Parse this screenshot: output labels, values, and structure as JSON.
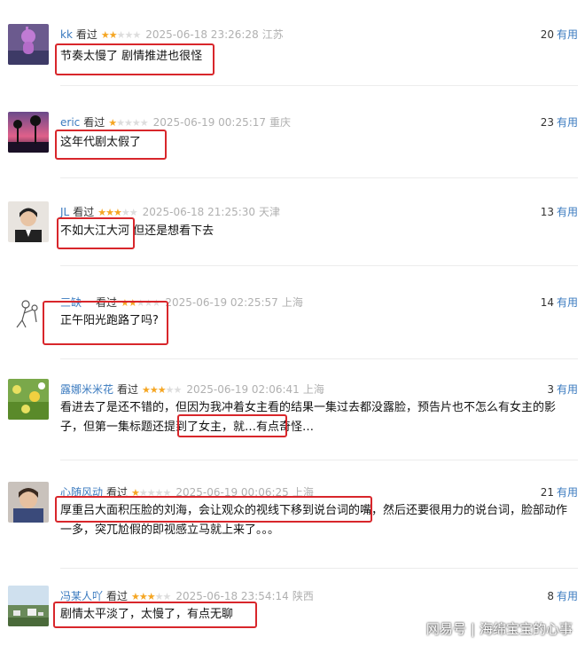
{
  "reviews": [
    {
      "user": "kk",
      "action": "看过",
      "rating": 2,
      "time": "2025-06-18 23:26:28",
      "location": "江苏",
      "votes": "20",
      "votes_label": "有用",
      "content": "节奏太慢了 剧情推进也很怪",
      "avatar_icon": "pink-cartoon-avatar"
    },
    {
      "user": "eric",
      "action": "看过",
      "rating": 1,
      "time": "2025-06-19 00:25:17",
      "location": "重庆",
      "votes": "23",
      "votes_label": "有用",
      "content": "这年代剧太假了",
      "avatar_icon": "sunset-palm-avatar"
    },
    {
      "user": "JL",
      "action": "看过",
      "rating": 3,
      "time": "2025-06-18 21:25:30",
      "location": "天津",
      "votes": "13",
      "votes_label": "有用",
      "content": "不如大江大河 但还是想看下去",
      "avatar_icon": "person-portrait-avatar"
    },
    {
      "user": "三缺一",
      "action": "看过",
      "rating": 2,
      "time": "2025-06-19 02:25:57",
      "location": "上海",
      "votes": "14",
      "votes_label": "有用",
      "content": "正午阳光跑路了吗?",
      "avatar_icon": "sketch-figures-avatar"
    },
    {
      "user": "露娜米米花",
      "action": "看过",
      "rating": 3,
      "time": "2025-06-19 02:06:41",
      "location": "上海",
      "votes": "3",
      "votes_label": "有用",
      "content": "看进去了是还不错的，但因为我冲着女主看的结果一集过去都没露脸，预告片也不怎么有女主的影子，但第一集标题还提到了女主，就…有点奇怪…",
      "avatar_icon": "flower-field-avatar"
    },
    {
      "user": "心随风动",
      "action": "看过",
      "rating": 1,
      "time": "2025-06-19 00:06:25",
      "location": "上海",
      "votes": "21",
      "votes_label": "有用",
      "content": "厚重吕大面积压脸的刘海，会让观众的视线下移到说台词的嘴，然后还要很用力的说台词，脸部动作一多，突兀尬假的即视感立马就上来了。。。",
      "avatar_icon": "selfie-avatar"
    },
    {
      "user": "冯某人吖",
      "action": "看过",
      "rating": 3,
      "time": "2025-06-18 23:54:14",
      "location": "陕西",
      "votes": "8",
      "votes_label": "有用",
      "content": "剧情太平淡了，太慢了，有点无聊",
      "avatar_icon": "landscape-avatar"
    }
  ],
  "watermark": {
    "brand": "网易号",
    "separator": "|",
    "author": "海绵宝宝的心事"
  }
}
